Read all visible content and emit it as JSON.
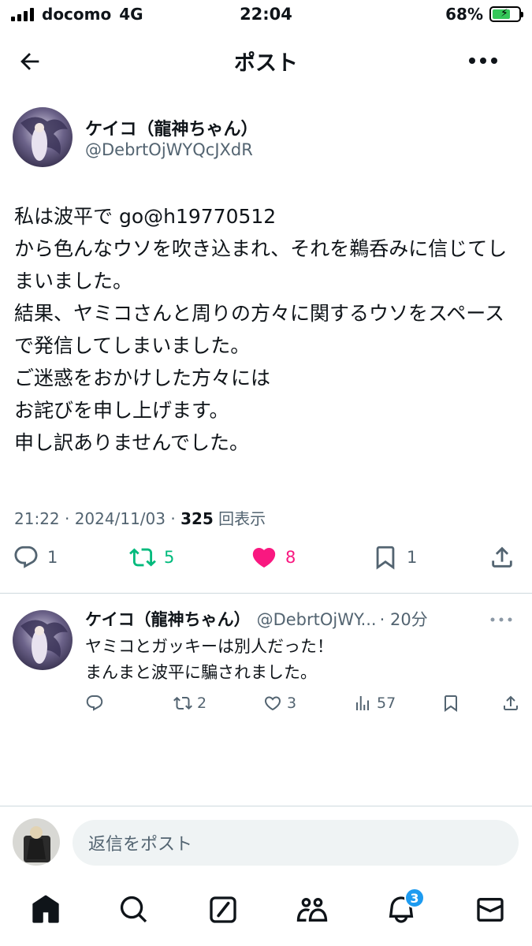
{
  "status_bar": {
    "carrier": "docomo",
    "network": "4G",
    "time": "22:04",
    "battery": "68%",
    "battery_level": 0.68
  },
  "header": {
    "title": "ポスト",
    "back_icon": "arrow-left-icon",
    "more_icon": "more-horizontal-icon"
  },
  "post": {
    "author_name": "ケイコ（龍神ちゃん）",
    "author_handle": "@DebrtOjWYQcJXdR",
    "body": "私は波平で go@h19770512\nから色んなウソを吹き込まれ、それを鵜呑みに信じてしまいました。\n結果、ヤミコさんと周りの方々に関するウソをスペースで発信してしまいました。\nご迷惑をおかけした方々には\nお詫びを申し上げます。\n申し訳ありませんでした。",
    "timestamp": "21:22 · 2024/11/03 · ",
    "views_count": "325",
    "views_label": " 回表示",
    "actions": {
      "reply_count": "1",
      "repost_count": "5",
      "like_count": "8",
      "bookmark_count": "1"
    },
    "colors": {
      "repost": "#00ba7c",
      "like": "#f91880"
    }
  },
  "reply": {
    "author_name": "ケイコ（龍神ちゃん）",
    "author_handle": "@DebrtOjWY...",
    "time": "· 20分",
    "text": "ヤミコとガッキーは別人だった！\nまんまと波平に騙されました。",
    "actions": {
      "reply_count": "",
      "repost_count": "2",
      "like_count": "3",
      "views_count": "57"
    }
  },
  "composer": {
    "placeholder": "返信をポスト"
  },
  "tabbar": {
    "items": [
      "home-icon",
      "search-icon",
      "compose-icon",
      "communities-icon",
      "notifications-icon",
      "messages-icon"
    ],
    "notifications_badge": "3"
  }
}
